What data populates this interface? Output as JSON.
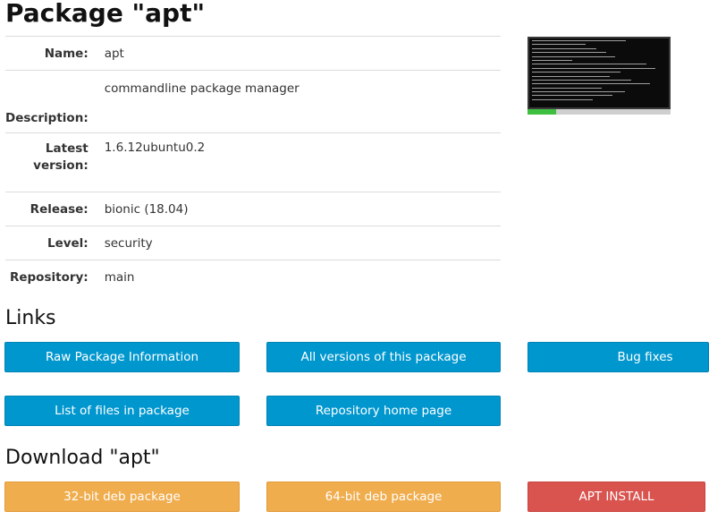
{
  "title": "Package \"apt\"",
  "info": {
    "name_label": "Name:",
    "name_value": "apt",
    "description_label": "Description:",
    "description_value": "commandline package manager",
    "version_label_1": "Latest",
    "version_label_2": "version:",
    "version_value": "1.6.12ubuntu0.2",
    "release_label": "Release:",
    "release_value": "bionic (18.04)",
    "level_label": "Level:",
    "level_value": "security",
    "repository_label": "Repository:",
    "repository_value": "main"
  },
  "links": {
    "heading": "Links",
    "raw_info": "Raw Package Information",
    "all_versions": "All versions of this package",
    "bug_fixes": "Bug fixes",
    "file_list": "List of files in package",
    "repo_home": "Repository home page"
  },
  "download": {
    "heading": "Download \"apt\"",
    "deb32": "32-bit deb package",
    "deb64": "64-bit deb package",
    "apt_install": "APT INSTALL"
  },
  "colors": {
    "link_button": "#0097cf",
    "download_button": "#f0ad4e",
    "install_button": "#d9534f"
  }
}
